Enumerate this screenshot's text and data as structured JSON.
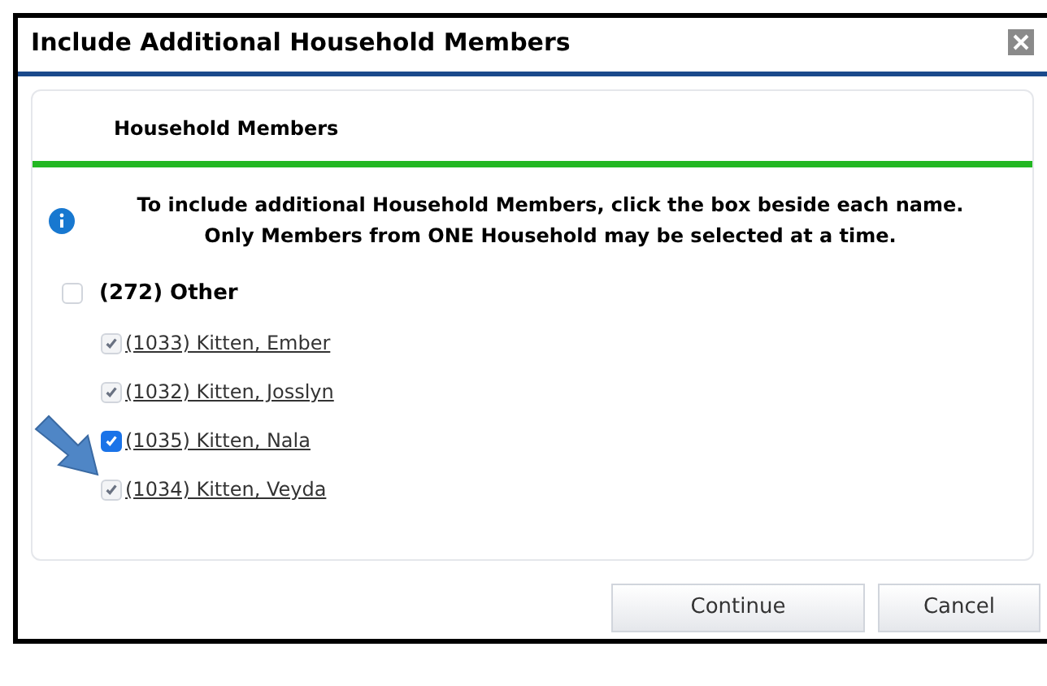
{
  "window": {
    "title": "Include Additional Household Members"
  },
  "panel": {
    "title": "Household Members"
  },
  "info": "To include additional Household Members, click the box beside each name. Only Members from ONE Household may be selected at a time.",
  "household": {
    "label": "(272) Other",
    "checked": false,
    "disabled": false
  },
  "members": [
    {
      "label": "(1033) Kitten, Ember",
      "checked": true,
      "disabled": true
    },
    {
      "label": "(1032) Kitten, Josslyn",
      "checked": true,
      "disabled": true
    },
    {
      "label": "(1035) Kitten, Nala",
      "checked": true,
      "disabled": false
    },
    {
      "label": "(1034) Kitten, Veyda",
      "checked": true,
      "disabled": true
    }
  ],
  "buttons": [
    "Continue",
    "Cancel"
  ]
}
